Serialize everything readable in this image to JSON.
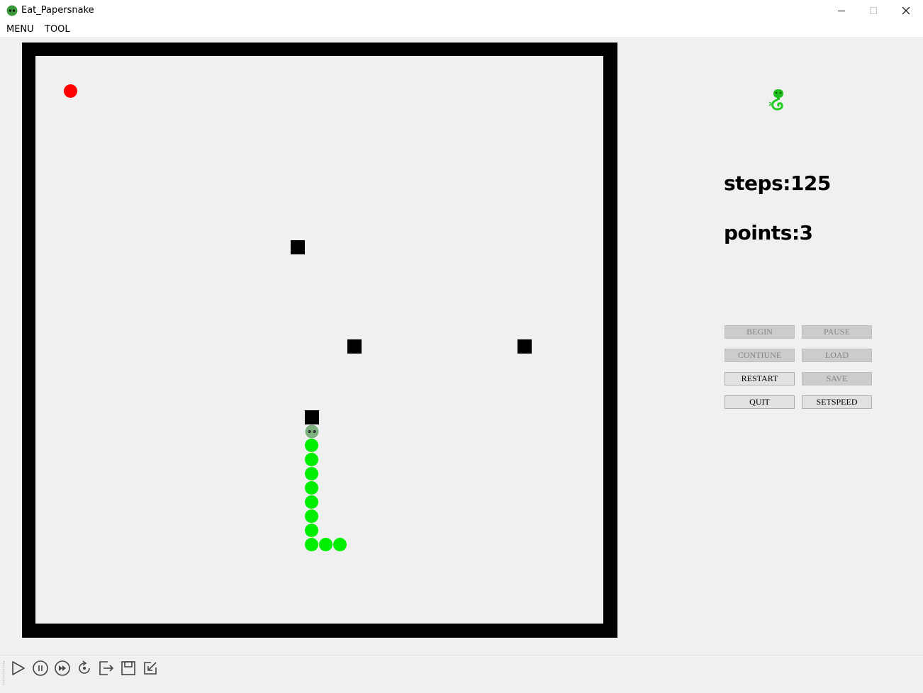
{
  "window": {
    "title": "Eat_Papersnake",
    "controls": [
      "minimize",
      "maximize",
      "close"
    ]
  },
  "menu": {
    "items": [
      "MENU",
      "TOOL"
    ]
  },
  "game": {
    "board_grid": "40x40",
    "food": {
      "col": 2,
      "row": 2,
      "color": "#ff0000"
    },
    "obstacles": [
      {
        "col": 18,
        "row": 13
      },
      {
        "col": 22,
        "row": 20
      },
      {
        "col": 34,
        "row": 20
      },
      {
        "col": 19,
        "row": 25
      }
    ],
    "snake": {
      "head": {
        "col": 19,
        "row": 26
      },
      "body": [
        {
          "col": 19,
          "row": 27
        },
        {
          "col": 19,
          "row": 28
        },
        {
          "col": 19,
          "row": 29
        },
        {
          "col": 19,
          "row": 30
        },
        {
          "col": 19,
          "row": 31
        },
        {
          "col": 19,
          "row": 32
        },
        {
          "col": 19,
          "row": 33
        },
        {
          "col": 19,
          "row": 34
        },
        {
          "col": 20,
          "row": 34
        },
        {
          "col": 21,
          "row": 34
        }
      ],
      "body_color": "#00ee00"
    }
  },
  "stats": {
    "steps_text": "steps:125",
    "points_text": "points:3"
  },
  "buttons": [
    {
      "id": "begin",
      "label": "BEGIN",
      "enabled": false
    },
    {
      "id": "pause",
      "label": "PAUSE",
      "enabled": false
    },
    {
      "id": "contiune",
      "label": "CONTIUNE",
      "enabled": false
    },
    {
      "id": "load",
      "label": "LOAD",
      "enabled": false
    },
    {
      "id": "restart",
      "label": "RESTART",
      "enabled": true
    },
    {
      "id": "save",
      "label": "SAVE",
      "enabled": false
    },
    {
      "id": "quit",
      "label": "QUIT",
      "enabled": true
    },
    {
      "id": "setspeed",
      "label": "SETSPEED",
      "enabled": true
    }
  ],
  "toolbar": {
    "icons": [
      "play-icon",
      "pause-icon",
      "fast-forward-icon",
      "restart-icon",
      "exit-icon",
      "save-icon",
      "load-icon"
    ]
  }
}
